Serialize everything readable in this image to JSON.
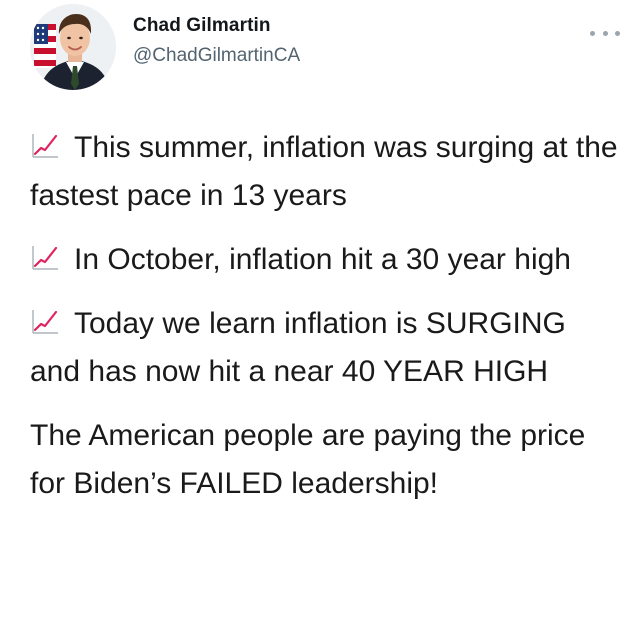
{
  "user": {
    "display_name": "Chad Gilmartin",
    "handle": "@ChadGilmartinCA"
  },
  "icons": {
    "avatar": "profile-photo",
    "more": "more-horizontal-icon",
    "paragraph_emoji": "chart-increasing-icon"
  },
  "tweet": {
    "paragraphs": [
      {
        "emoji": true,
        "text": "This summer, inflation was surging at the fastest pace in 13 years"
      },
      {
        "emoji": true,
        "text": "In October, inflation hit a 30 year high"
      },
      {
        "emoji": true,
        "text": "Today we learn inflation is SURGING and has now hit a near 40 YEAR HIGH"
      },
      {
        "emoji": false,
        "text": "The American people are paying the price for Biden’s FAILED leadership!"
      }
    ]
  },
  "colors": {
    "name": "#14171a",
    "handle": "#536471",
    "emoji_line": "#e0245e"
  }
}
